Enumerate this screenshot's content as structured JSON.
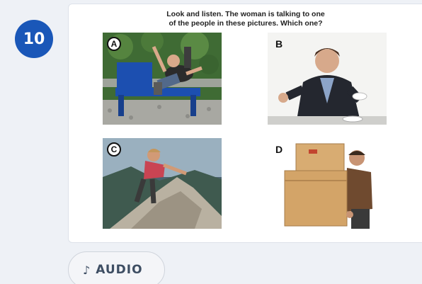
{
  "question": {
    "number": "10",
    "prompt_line1": "Look and listen. The woman is talking to one",
    "prompt_line2": "of the people in these pictures. Which one?"
  },
  "options": [
    {
      "letter": "A",
      "icon": "photo-man-falling-off-bench"
    },
    {
      "letter": "B",
      "icon": "photo-man-in-suit-spilling-drink"
    },
    {
      "letter": "C",
      "icon": "photo-woman-rock-climbing"
    },
    {
      "letter": "D",
      "icon": "photo-man-carrying-boxes"
    }
  ],
  "audio_button": {
    "icon": "music-note-icon",
    "note_glyph": "♪",
    "label": "AUDIO"
  },
  "colors": {
    "accent": "#1a57b8",
    "background": "#eef1f6",
    "button_text": "#3e4e63"
  }
}
